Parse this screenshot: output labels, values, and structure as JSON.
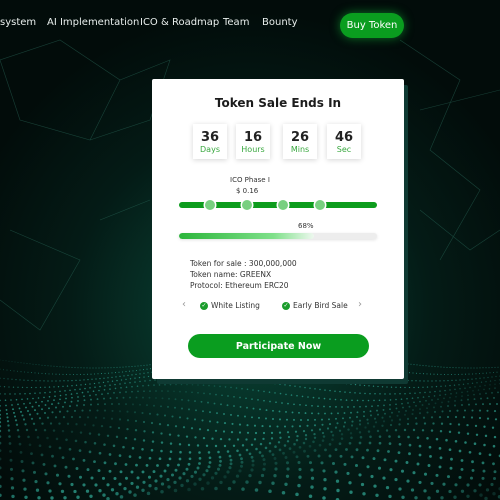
{
  "nav": {
    "items": [
      {
        "label": "system"
      },
      {
        "label": "AI Implementation"
      },
      {
        "label": "ICO & Roadmap"
      },
      {
        "label": "Team"
      },
      {
        "label": "Bounty"
      }
    ],
    "buy_label": "Buy Token"
  },
  "card": {
    "title": "Token Sale Ends In",
    "countdown": [
      {
        "value": "36",
        "unit": "Days"
      },
      {
        "value": "16",
        "unit": "Hours"
      },
      {
        "value": "26",
        "unit": "Mins"
      },
      {
        "value": "46",
        "unit": "Sec"
      }
    ],
    "phase": {
      "label": "ICO Phase I",
      "price": "$ 0.16"
    },
    "progress": {
      "percent_label": "68%",
      "value": 0.68
    },
    "info": [
      "Token  for sale : 300,000,000",
      "Token name: GREENX",
      "Protocol: Ethereum ERC20"
    ],
    "features": [
      "White Listing",
      "Early Bird Sale"
    ],
    "cta_label": "Participate Now"
  },
  "colors": {
    "accent": "#0a9d1f",
    "unit_text": "#39a83f",
    "background": "#03120f"
  },
  "icons": {
    "prev": "chevron-left-icon",
    "next": "chevron-right-icon",
    "feature": "check-circle-icon"
  }
}
